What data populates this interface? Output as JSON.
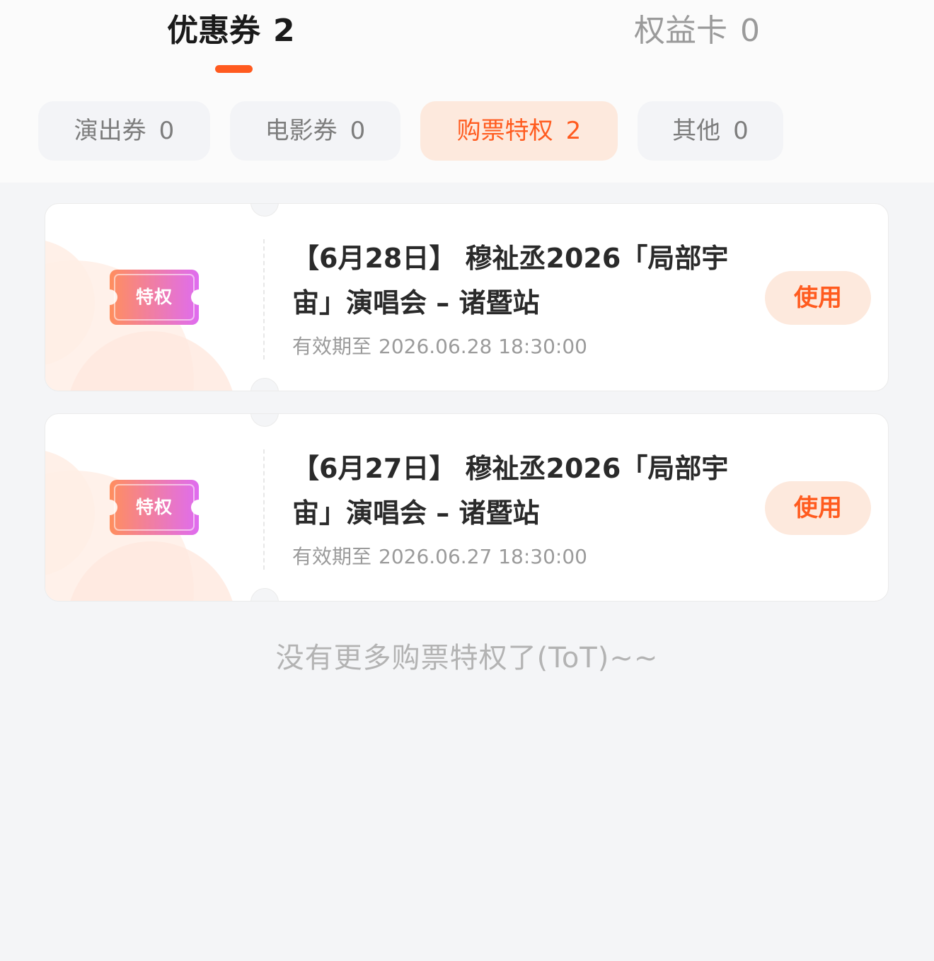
{
  "main_tabs": [
    {
      "label": "优惠券",
      "count": "2"
    },
    {
      "label": "权益卡",
      "count": "0"
    }
  ],
  "sub_tabs": [
    {
      "label": "演出券",
      "count": "0"
    },
    {
      "label": "电影券",
      "count": "0"
    },
    {
      "label": "购票特权",
      "count": "2"
    },
    {
      "label": "其他",
      "count": "0"
    }
  ],
  "coupons": [
    {
      "badge": "特权",
      "title": "【6月28日】 穆祉丞2026「局部宇宙」演唱会 – 诸暨站",
      "validity_label": "有效期至",
      "validity_date": "2026.06.28 18:30:00",
      "button": "使用"
    },
    {
      "badge": "特权",
      "title": "【6月27日】 穆祉丞2026「局部宇宙」演唱会 – 诸暨站",
      "validity_label": "有效期至",
      "validity_date": "2026.06.27 18:30:00",
      "button": "使用"
    }
  ],
  "end_message": "没有更多购票特权了(ToT)~~",
  "colors": {
    "accent": "#ff5b1f",
    "accent_bg": "#fde9dd",
    "badge_gradient_start": "#ff8e5e",
    "badge_gradient_end": "#df6cf0"
  }
}
